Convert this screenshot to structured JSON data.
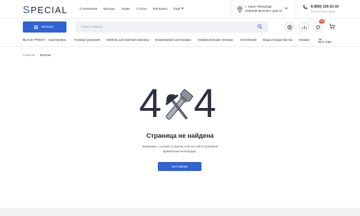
{
  "header": {
    "logo": "SPECIAL",
    "nav": [
      "О компании",
      "Бренды",
      "Акции",
      "Статьи",
      "Магазины",
      "Ещё"
    ],
    "location": [
      "г. Санкт-Петербург,",
      "Невский проспект, дом 11"
    ],
    "phone": "8 (800) 100-10-10",
    "phone_sub": "Все способы связи"
  },
  "search": {
    "catalog_label": "Каталог",
    "placeholder": "Поиск товаров",
    "favorites_count": "99"
  },
  "categories": [
    "BLACK FRIDAY",
    "Сантехника",
    "Готовые решения",
    "Мебель для ванной комнаты",
    "Инженерная сантехника",
    "Климатическая техника",
    "Отопление",
    "Вода и водоочистка",
    "Климат",
    "Все това"
  ],
  "breadcrumb": [
    "Главная",
    "Каталог"
  ],
  "error": {
    "digit_left": "4",
    "digit_right": "4",
    "title": "Страница не найдена",
    "description": "Возможно, ссылка устарела, или на сайте возникли временные неполадки.",
    "button": "На главную"
  },
  "colors": {
    "accent": "#2f62d3",
    "badge": "#e0592a"
  }
}
